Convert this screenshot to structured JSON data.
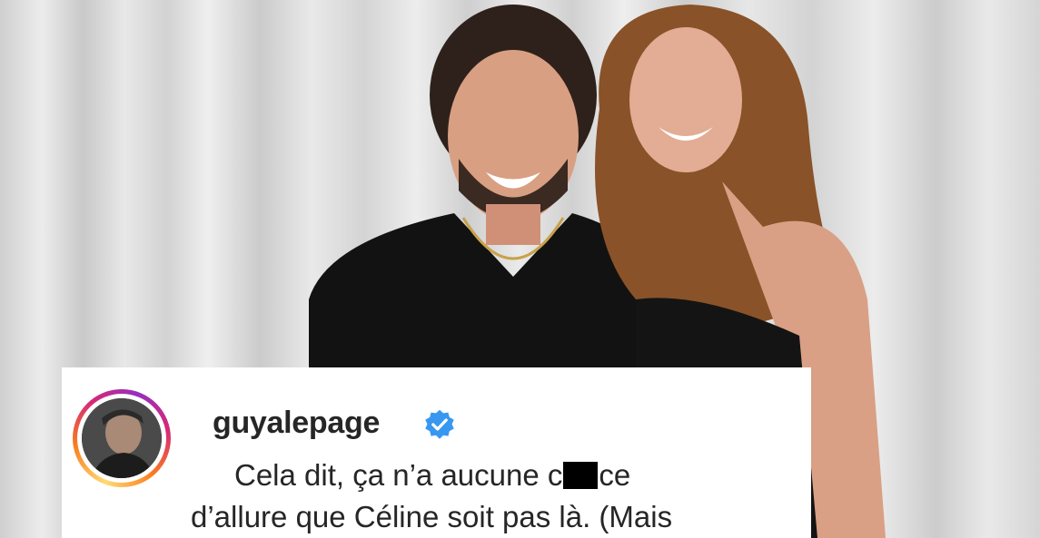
{
  "post": {
    "username": "guyalepage",
    "verified": true,
    "caption_line1_a": "Cela dit, ça n’a aucune c",
    "caption_line1_b": "ce",
    "caption_line2": "d’allure que Céline soit pas là. (Mais",
    "ring_colors": [
      "#feda75",
      "#fa7e1e",
      "#d62976",
      "#962fbf"
    ],
    "verified_color": "#3897f0"
  },
  "icons": [
    "verified-badge-icon"
  ]
}
